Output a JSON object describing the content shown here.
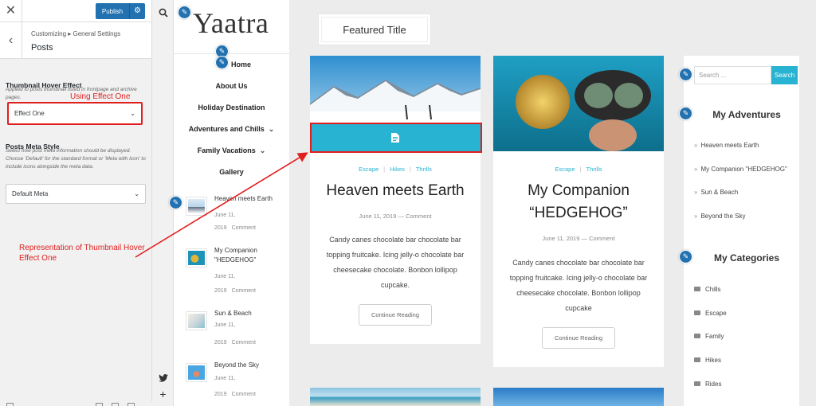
{
  "customizer": {
    "close_icon": "close-icon",
    "publish_label": "Publish",
    "breadcrumb": "Customizing ▸ General Settings",
    "section_title": "Posts",
    "hover": {
      "title": "Thumbnail Hover Effect",
      "description": "Applied to posts thumbnail listed in frontpage and archive pages.",
      "selected": "Effect One"
    },
    "meta": {
      "title": "Posts Meta Style",
      "description": "Select how post meta information should be displayed. Choose 'Default' for the standard format or 'Meta with Icon' to include icons alongside the meta data.",
      "selected": "Default Meta"
    }
  },
  "site": {
    "logo": "Yaatra",
    "nav": [
      {
        "label": "Home"
      },
      {
        "label": "About Us"
      },
      {
        "label": "Holiday Destination"
      },
      {
        "label": "Adventures and Chills"
      },
      {
        "label": "Family Vacations"
      },
      {
        "label": "Gallery"
      }
    ],
    "recent_posts": [
      {
        "title": "Heaven meets Earth",
        "date": "June 11,",
        "year": "2019",
        "comment": "Comment"
      },
      {
        "title": "My Companion \"HEDGEHOG\"",
        "date": "June 11,",
        "year": "2019",
        "comment": "Comment"
      },
      {
        "title": "Sun & Beach",
        "date": "June 11,",
        "year": "2019",
        "comment": "Comment"
      },
      {
        "title": "Beyond the Sky",
        "date": "June 11,",
        "year": "2019",
        "comment": "Comment"
      }
    ]
  },
  "content": {
    "featured_title": "Featured Title",
    "posts": [
      {
        "categories": [
          "Escape",
          "Hikes",
          "Thrills"
        ],
        "title": "Heaven meets Earth",
        "date": "June 11, 2019",
        "comment": "Comment",
        "excerpt": "Candy canes chocolate bar chocolate bar topping fruitcake. Icing jelly-o chocolate bar cheesecake chocolate. Bonbon lollipop cupcake.",
        "button": "Continue Reading"
      },
      {
        "categories": [
          "Escape",
          "Thrills"
        ],
        "title": "My Companion “HEDGEHOG”",
        "date": "June 11, 2019",
        "comment": "Comment",
        "excerpt": "Candy canes chocolate bar chocolate bar topping fruitcake. Icing jelly-o chocolate bar cheesecake chocolate. Bonbon lollipop cupcake",
        "button": "Continue Reading"
      }
    ]
  },
  "widgets": {
    "search_placeholder": "Search ...",
    "search_button": "Search",
    "adventures_title": "My Adventures",
    "adventures": [
      "Heaven meets Earth",
      "My Companion \"HEDGEHOG\"",
      "Sun & Beach",
      "Beyond the Sky"
    ],
    "categories_title": "My Categories",
    "categories": [
      "Chills",
      "Escape",
      "Family",
      "Hikes",
      "Rides"
    ]
  },
  "annotations": {
    "using": "Using Effect One",
    "representation": "Representation of Thumbnail Hover Effect One"
  },
  "colors": {
    "accent": "#27b3d1",
    "wp_blue": "#2271b1",
    "annotation_red": "#e01e1e"
  }
}
